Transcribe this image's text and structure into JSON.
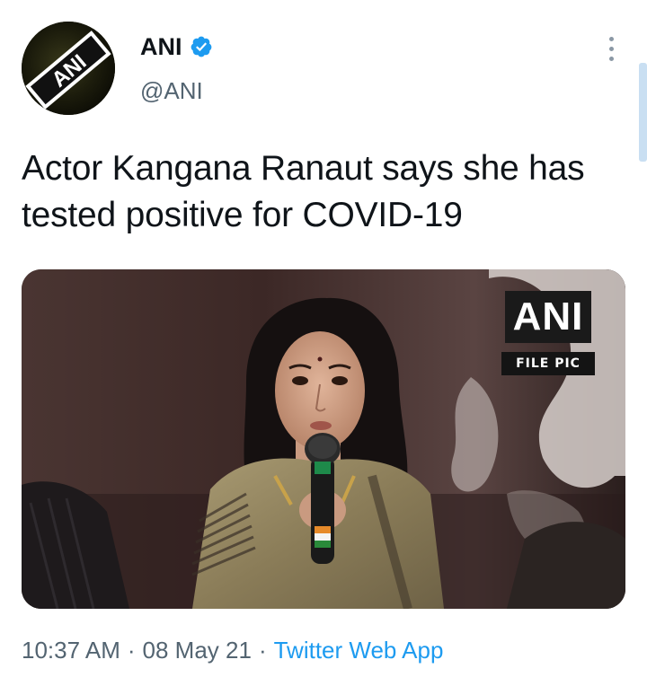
{
  "account": {
    "display_name": "ANI",
    "handle": "@ANI",
    "avatar_logo_text": "ANI",
    "verified": true
  },
  "tweet": {
    "text": "Actor Kangana Ranaut says she has tested positive for COVID-19",
    "media_watermark": {
      "logo": "ANI",
      "label": "FILE PIC"
    },
    "meta": {
      "time": "10:37 AM",
      "separator": "·",
      "date": "08 May 21",
      "source": "Twitter Web App"
    }
  },
  "icons": {
    "verified": "verified-badge-icon",
    "more": "more-vertical-icon"
  },
  "colors": {
    "text_primary": "#0f1419",
    "text_secondary": "#536471",
    "accent": "#1d9bf0"
  }
}
